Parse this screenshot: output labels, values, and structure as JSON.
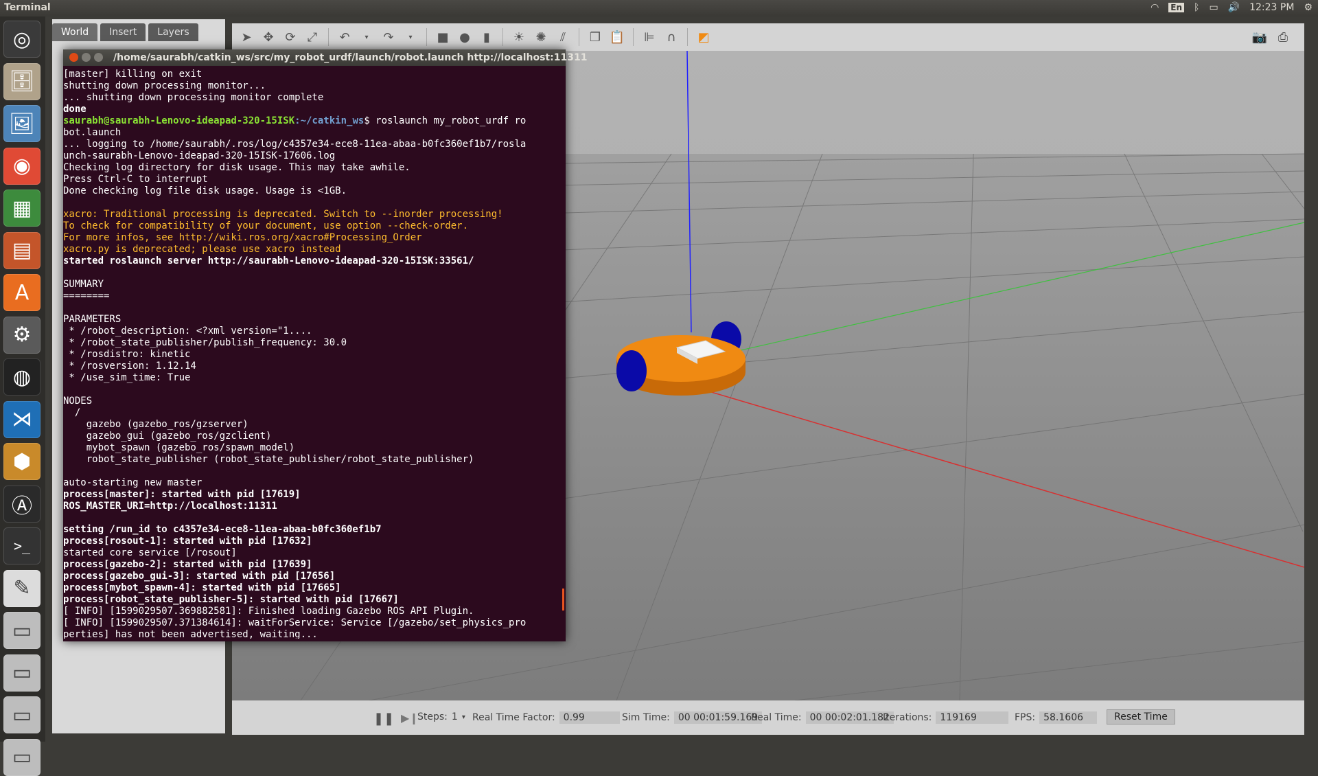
{
  "topbar": {
    "app_title": "Terminal",
    "keyboard": "En",
    "clock": "12:23 PM"
  },
  "launcher": [
    {
      "name": "dash-home",
      "icon": "ubuntu-logo-icon",
      "color": "#3a3a3a"
    },
    {
      "name": "files",
      "icon": "file-cabinet-icon",
      "color": "#b0a28a"
    },
    {
      "name": "image-viewer",
      "icon": "picture-icon",
      "color": "#4d84b8"
    },
    {
      "name": "chrome",
      "icon": "chrome-icon",
      "color": "#e04a35"
    },
    {
      "name": "spreadsheet",
      "icon": "spreadsheet-icon",
      "color": "#3d8b3d"
    },
    {
      "name": "presentation",
      "icon": "presentation-icon",
      "color": "#c4552a"
    },
    {
      "name": "software-center",
      "icon": "shopping-bag-icon",
      "color": "#e96d20"
    },
    {
      "name": "system-settings",
      "icon": "settings-tools-icon",
      "color": "#5a5a5a"
    },
    {
      "name": "camera-app",
      "icon": "camera-lens-icon",
      "color": "#222222"
    },
    {
      "name": "vscode",
      "icon": "vscode-icon",
      "color": "#1f6fb6"
    },
    {
      "name": "virtualbox",
      "icon": "cube-icon",
      "color": "#c98a2a"
    },
    {
      "name": "software-updater",
      "icon": "updater-icon",
      "color": "#2a2a2a"
    },
    {
      "name": "terminal",
      "icon": "terminal-icon",
      "color": "#333333"
    },
    {
      "name": "text-editor",
      "icon": "pencil-icon",
      "color": "#dcdcdc"
    },
    {
      "name": "drive-1",
      "icon": "disk-icon",
      "color": "#bdbdbd"
    },
    {
      "name": "drive-2",
      "icon": "disk-icon",
      "color": "#bdbdbd"
    },
    {
      "name": "drive-3",
      "icon": "disk-icon",
      "color": "#bdbdbd"
    },
    {
      "name": "drive-4",
      "icon": "disk-icon",
      "color": "#bdbdbd"
    }
  ],
  "gazebo": {
    "tabs": [
      "World",
      "Insert",
      "Layers"
    ],
    "bottom": {
      "steps_label": "Steps:",
      "steps_value": "1",
      "rtf_label": "Real Time Factor:",
      "rtf_value": "0.99",
      "sim_label": "Sim Time:",
      "sim_value": "00 00:01:59.169",
      "real_label": "Real Time:",
      "real_value": "00 00:02:01.182",
      "iter_label": "Iterations:",
      "iter_value": "119169",
      "fps_label": "FPS:",
      "fps_value": "58.1606",
      "reset_label": "Reset Time"
    },
    "colors": {
      "ground": "#888888",
      "robot_body": "#f08a12",
      "wheels": "#0a0aa8",
      "x_axis": "#d83030",
      "y_axis": "#40c040",
      "z_axis": "#2020ff"
    }
  },
  "terminal": {
    "title": "/home/saurabh/catkin_ws/src/my_robot_urdf/launch/robot.launch http://localhost:11311",
    "lines": [
      {
        "t": "[master] killing on exit",
        "s": "normal"
      },
      {
        "t": "shutting down processing monitor...",
        "s": "normal"
      },
      {
        "t": "... shutting down processing monitor complete",
        "s": "normal"
      },
      {
        "t": "done",
        "s": "bold"
      },
      {
        "t": "",
        "s": "prompt",
        "user": "saurabh@saurabh-Lenovo-ideapad-320-15ISK",
        "path": ":~/catkin_ws",
        "cmd": "$ roslaunch my_robot_urdf ro"
      },
      {
        "t": "bot.launch",
        "s": "normal"
      },
      {
        "t": "... logging to /home/saurabh/.ros/log/c4357e34-ece8-11ea-abaa-b0fc360ef1b7/rosla",
        "s": "normal"
      },
      {
        "t": "unch-saurabh-Lenovo-ideapad-320-15ISK-17606.log",
        "s": "normal"
      },
      {
        "t": "Checking log directory for disk usage. This may take awhile.",
        "s": "normal"
      },
      {
        "t": "Press Ctrl-C to interrupt",
        "s": "normal"
      },
      {
        "t": "Done checking log file disk usage. Usage is <1GB.",
        "s": "normal"
      },
      {
        "t": "",
        "s": "normal"
      },
      {
        "t": "xacro: Traditional processing is deprecated. Switch to --inorder processing!",
        "s": "warn"
      },
      {
        "t": "To check for compatibility of your document, use option --check-order.",
        "s": "warn"
      },
      {
        "t": "For more infos, see http://wiki.ros.org/xacro#Processing_Order",
        "s": "warn"
      },
      {
        "t": "xacro.py is deprecated; please use xacro instead",
        "s": "warn"
      },
      {
        "t": "started roslaunch server http://saurabh-Lenovo-ideapad-320-15ISK:33561/",
        "s": "bold"
      },
      {
        "t": "",
        "s": "normal"
      },
      {
        "t": "SUMMARY",
        "s": "normal"
      },
      {
        "t": "========",
        "s": "normal"
      },
      {
        "t": "",
        "s": "normal"
      },
      {
        "t": "PARAMETERS",
        "s": "normal"
      },
      {
        "t": " * /robot_description: <?xml version=\"1....",
        "s": "normal"
      },
      {
        "t": " * /robot_state_publisher/publish_frequency: 30.0",
        "s": "normal"
      },
      {
        "t": " * /rosdistro: kinetic",
        "s": "normal"
      },
      {
        "t": " * /rosversion: 1.12.14",
        "s": "normal"
      },
      {
        "t": " * /use_sim_time: True",
        "s": "normal"
      },
      {
        "t": "",
        "s": "normal"
      },
      {
        "t": "NODES",
        "s": "normal"
      },
      {
        "t": "  /",
        "s": "normal"
      },
      {
        "t": "    gazebo (gazebo_ros/gzserver)",
        "s": "normal"
      },
      {
        "t": "    gazebo_gui (gazebo_ros/gzclient)",
        "s": "normal"
      },
      {
        "t": "    mybot_spawn (gazebo_ros/spawn_model)",
        "s": "normal"
      },
      {
        "t": "    robot_state_publisher (robot_state_publisher/robot_state_publisher)",
        "s": "normal"
      },
      {
        "t": "",
        "s": "normal"
      },
      {
        "t": "auto-starting new master",
        "s": "normal"
      },
      {
        "t": "process[master]: started with pid [17619]",
        "s": "bold"
      },
      {
        "t": "ROS_MASTER_URI=http://localhost:11311",
        "s": "bold"
      },
      {
        "t": "",
        "s": "normal"
      },
      {
        "t": "setting /run_id to c4357e34-ece8-11ea-abaa-b0fc360ef1b7",
        "s": "bold"
      },
      {
        "t": "process[rosout-1]: started with pid [17632]",
        "s": "bold"
      },
      {
        "t": "started core service [/rosout]",
        "s": "normal"
      },
      {
        "t": "process[gazebo-2]: started with pid [17639]",
        "s": "bold"
      },
      {
        "t": "process[gazebo_gui-3]: started with pid [17656]",
        "s": "bold"
      },
      {
        "t": "process[mybot_spawn-4]: started with pid [17665]",
        "s": "bold"
      },
      {
        "t": "process[robot_state_publisher-5]: started with pid [17667]",
        "s": "bold"
      },
      {
        "t": "[ INFO] [1599029507.369882581]: Finished loading Gazebo ROS API Plugin.",
        "s": "normal"
      },
      {
        "t": "[ INFO] [1599029507.371384614]: waitForService: Service [/gazebo/set_physics_pro",
        "s": "normal"
      },
      {
        "t": "perties] has not been advertised, waiting...",
        "s": "normal"
      }
    ]
  }
}
